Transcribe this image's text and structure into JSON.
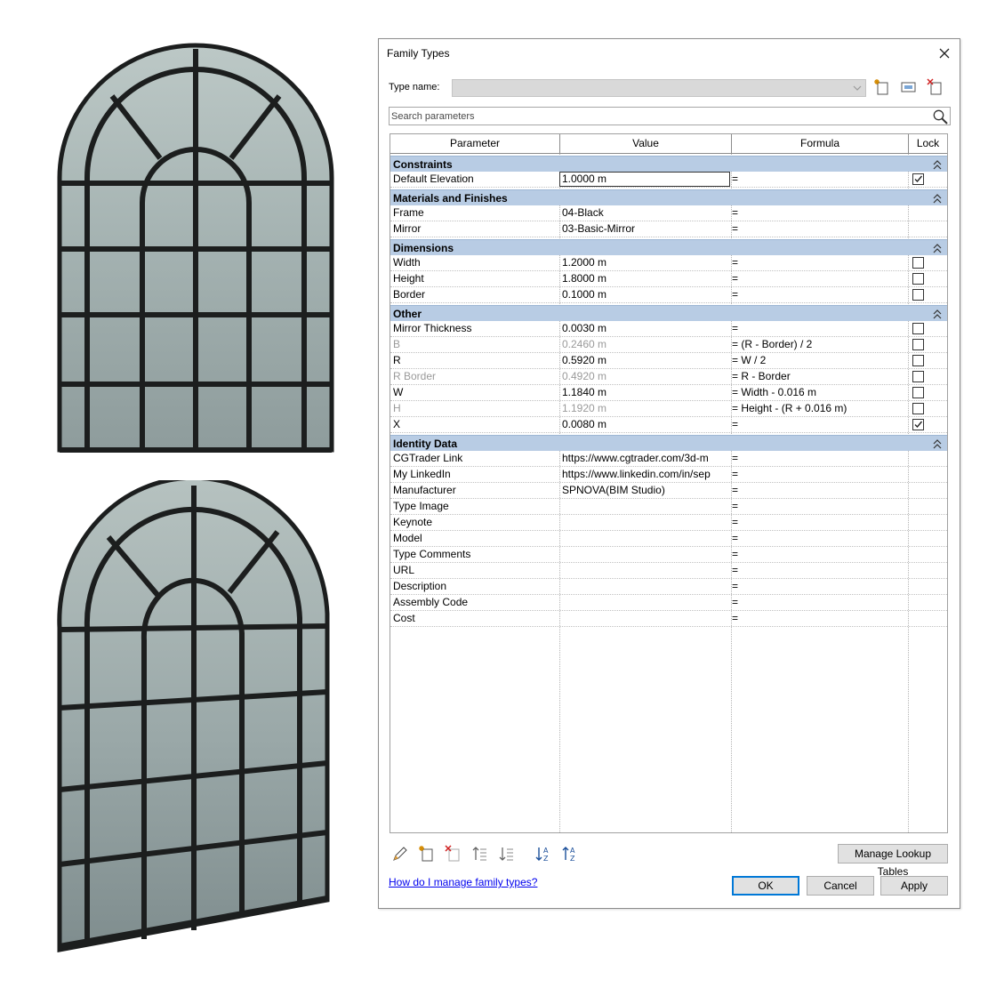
{
  "dialog": {
    "title": "Family Types",
    "type_name_label": "Type name:",
    "type_name_value": "",
    "search_placeholder": "Search parameters",
    "columns": {
      "parameter": "Parameter",
      "value": "Value",
      "formula": "Formula",
      "lock": "Lock"
    },
    "groups": [
      {
        "name": "Constraints",
        "rows": [
          {
            "param": "Default Elevation",
            "value": "1.0000 m",
            "formula": "=",
            "lock": true,
            "dim": false,
            "editing": true
          }
        ]
      },
      {
        "name": "Materials and Finishes",
        "rows": [
          {
            "param": "Frame",
            "value": "04-Black",
            "formula": "=",
            "lock": null,
            "dim": false
          },
          {
            "param": "Mirror",
            "value": "03-Basic-Mirror",
            "formula": "=",
            "lock": null,
            "dim": false
          }
        ]
      },
      {
        "name": "Dimensions",
        "rows": [
          {
            "param": "Width",
            "value": "1.2000 m",
            "formula": "=",
            "lock": false,
            "dim": false
          },
          {
            "param": "Height",
            "value": "1.8000 m",
            "formula": "=",
            "lock": false,
            "dim": false
          },
          {
            "param": "Border",
            "value": "0.1000 m",
            "formula": "=",
            "lock": false,
            "dim": false
          }
        ]
      },
      {
        "name": "Other",
        "rows": [
          {
            "param": "Mirror Thickness",
            "value": "0.0030 m",
            "formula": "=",
            "lock": false,
            "dim": false
          },
          {
            "param": "B",
            "value": "0.2460 m",
            "formula": "= (R - Border) / 2",
            "lock": false,
            "dim": true
          },
          {
            "param": "R",
            "value": "0.5920 m",
            "formula": "= W / 2",
            "lock": false,
            "dim": false
          },
          {
            "param": "R Border",
            "value": "0.4920 m",
            "formula": "= R - Border",
            "lock": false,
            "dim": true
          },
          {
            "param": "W",
            "value": "1.1840 m",
            "formula": "= Width - 0.016 m",
            "lock": false,
            "dim": false
          },
          {
            "param": "H",
            "value": "1.1920 m",
            "formula": "= Height - (R + 0.016 m)",
            "lock": false,
            "dim": true
          },
          {
            "param": "X",
            "value": "0.0080 m",
            "formula": "=",
            "lock": true,
            "dim": false
          }
        ]
      },
      {
        "name": "Identity Data",
        "rows": [
          {
            "param": "CGTrader Link",
            "value": "https://www.cgtrader.com/3d-m",
            "formula": "=",
            "lock": null,
            "dim": false
          },
          {
            "param": "My LinkedIn",
            "value": "https://www.linkedin.com/in/sep",
            "formula": "=",
            "lock": null,
            "dim": false
          },
          {
            "param": "Manufacturer",
            "value": "SPNOVA(BIM Studio)",
            "formula": "=",
            "lock": null,
            "dim": false
          },
          {
            "param": "Type Image",
            "value": "",
            "formula": "=",
            "lock": null,
            "dim": false
          },
          {
            "param": "Keynote",
            "value": "",
            "formula": "=",
            "lock": null,
            "dim": false
          },
          {
            "param": "Model",
            "value": "",
            "formula": "=",
            "lock": null,
            "dim": false
          },
          {
            "param": "Type Comments",
            "value": "",
            "formula": "=",
            "lock": null,
            "dim": false
          },
          {
            "param": "URL",
            "value": "",
            "formula": "=",
            "lock": null,
            "dim": false
          },
          {
            "param": "Description",
            "value": "",
            "formula": "=",
            "lock": null,
            "dim": false
          },
          {
            "param": "Assembly Code",
            "value": "",
            "formula": "=",
            "lock": null,
            "dim": false
          },
          {
            "param": "Cost",
            "value": "",
            "formula": "=",
            "lock": null,
            "dim": false
          }
        ]
      }
    ],
    "buttons": {
      "manage_lookup": "Manage Lookup Tables",
      "ok": "OK",
      "cancel": "Cancel",
      "apply": "Apply"
    },
    "help_link": "How do I manage family types?"
  },
  "icons": {
    "toolbar_top": [
      "new-type-icon",
      "rename-type-icon",
      "delete-type-icon"
    ],
    "toolbar_bottom": [
      "edit-parameter-icon",
      "new-parameter-icon",
      "delete-parameter-icon",
      "move-up-icon",
      "move-down-icon",
      "sort-ascending-icon",
      "sort-descending-icon"
    ]
  },
  "colors": {
    "group_header": "#b8cce4",
    "primary_border": "#0078d7",
    "link": "#0000ee"
  }
}
